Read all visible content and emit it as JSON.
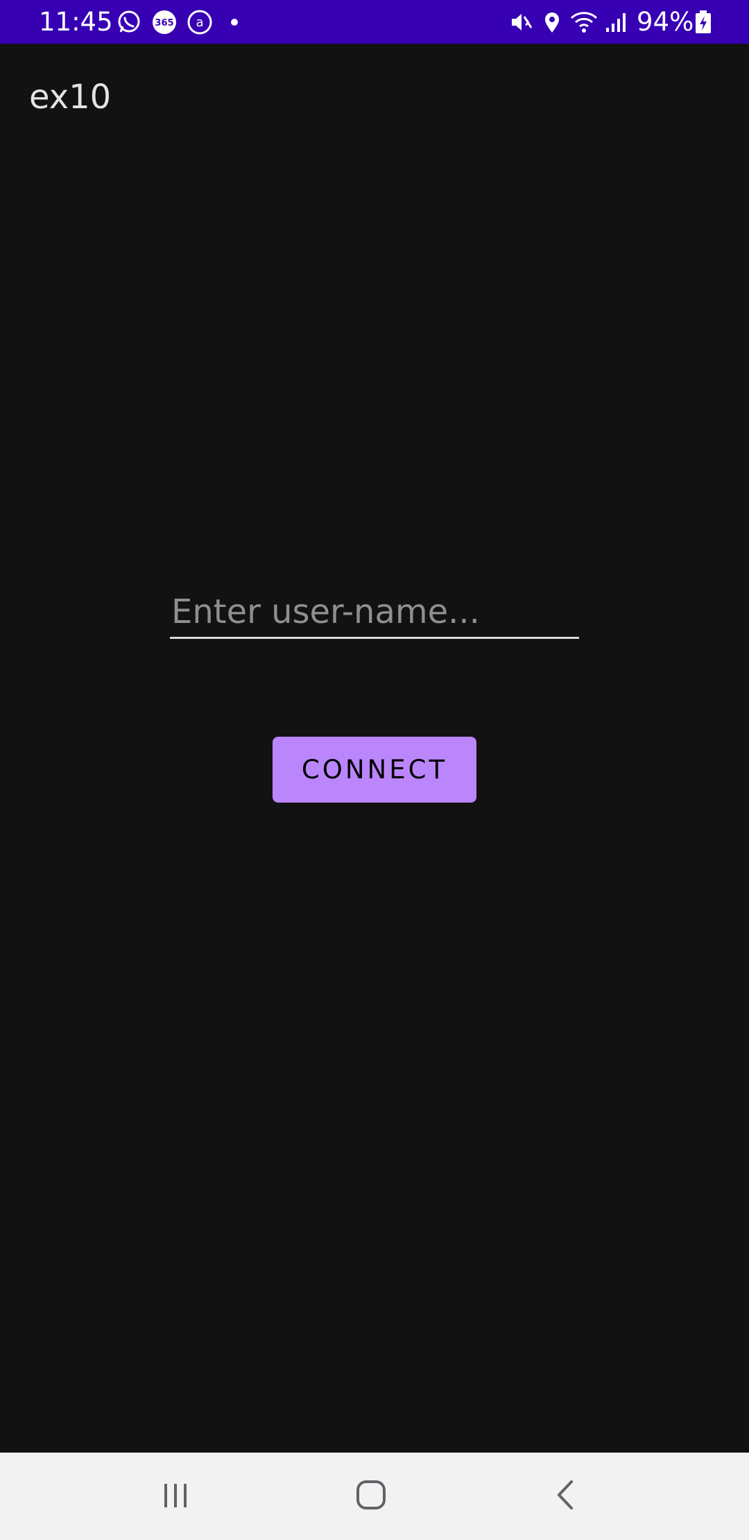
{
  "status_bar": {
    "time": "11:45",
    "battery": "94%",
    "background_color": "#3700b3",
    "left_icons": [
      "whatsapp-icon",
      "office365-icon",
      "at-sign-icon",
      "notification-dot-icon"
    ],
    "right_icons": [
      "mute-vibrate-icon",
      "location-icon",
      "wifi-icon",
      "signal-icon",
      "battery-charging-icon"
    ]
  },
  "app_bar": {
    "title": "ex10"
  },
  "form": {
    "username_placeholder": "Enter user-name...",
    "username_value": "",
    "connect_label": "CONNECT",
    "accent_color": "#bb86fc"
  },
  "nav_bar": {
    "buttons": [
      "recents-icon",
      "home-icon",
      "back-icon"
    ]
  },
  "colors": {
    "background": "#121212",
    "nav_background": "#f2f2f2"
  }
}
